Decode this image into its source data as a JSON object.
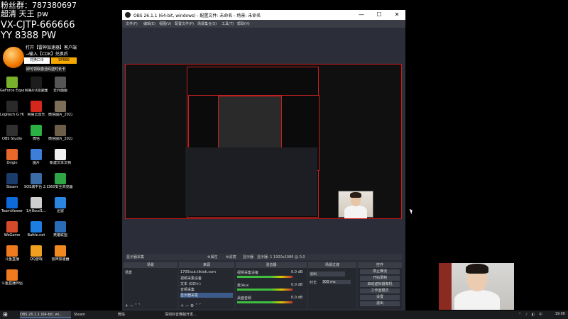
{
  "overlay": {
    "line1": "粉丝群：787380697",
    "line2": "超清 天王 pw",
    "line3": "VX-CJTP-666666",
    "line4": "YY 8388 PW"
  },
  "promo": {
    "l1": "打开【雷神加速器】客户端",
    "l2": "→输入【CDK】兑换后",
    "pill1": "兑换口令",
    "pill2": "SP666",
    "l3": "即可领取激活码送时长卡"
  },
  "desktop_icons": [
    {
      "label": "GeForce Experience",
      "color": "#79b12c"
    },
    {
      "label": "网易UU加速器",
      "color": "#1d1d1d"
    },
    {
      "label": "去外面版",
      "color": "#555555"
    },
    {
      "label": "Logitech G HUB",
      "color": "#2a2a2a"
    },
    {
      "label": "网易云音乐",
      "color": "#d4281d"
    },
    {
      "label": "微信图片_2022111",
      "color": "#7d6e5a"
    },
    {
      "label": "OBS Studio",
      "color": "#303030"
    },
    {
      "label": "微信",
      "color": "#2ab043"
    },
    {
      "label": "微信图片_2022091",
      "color": "#6d5e4a"
    },
    {
      "label": "Origin",
      "color": "#e8682c"
    },
    {
      "label": "图片",
      "color": "#3d7ed8"
    },
    {
      "label": "新建文本文档",
      "color": "#f0f0f0"
    },
    {
      "label": "Steam",
      "color": "#1b3c6a"
    },
    {
      "label": "SOS城平台 2.0",
      "color": "#3c6ca8"
    },
    {
      "label": "360安全浏览器",
      "color": "#2fa545"
    },
    {
      "label": "TeamViewer",
      "color": "#0e6ad8"
    },
    {
      "label": "1月8ocd1…",
      "color": "#cfcfcf"
    },
    {
      "label": "迅雷",
      "color": "#2a86e0"
    },
    {
      "label": "WeGame",
      "color": "#d44a2a"
    },
    {
      "label": "Battle.net",
      "color": "#1c7ee0"
    },
    {
      "label": "英雄联盟",
      "color": "#2b6cb8"
    },
    {
      "label": "斗鱼直播",
      "color": "#f07a20"
    },
    {
      "label": "QQ游戏",
      "color": "#f0a020"
    },
    {
      "label": "雷神加速器",
      "color": "#f08a20"
    },
    {
      "label": "斗鱼直播伴侣",
      "color": "#f07a20"
    }
  ],
  "obs": {
    "title": "OBS 26.1.1 (64-bit, windows) - 配置文件: 未命名 - 场景: 未命名",
    "btn_min": "—",
    "btn_max": "☐",
    "btn_close": "✕",
    "menu": [
      "文件(F)",
      "编辑(E)",
      "视图(V)",
      "配置文件(P)",
      "场景集合(S)",
      "工具(T)",
      "帮助(H)"
    ],
    "scene_bar": {
      "name": "显示器采集",
      "props": "⚙属性",
      "filters": "⚙滤镜",
      "display": "显示器",
      "display_val": "显示器: 1  1920x1080 @ 0,0"
    },
    "scenes": {
      "header": "场景",
      "items": [
        "场景"
      ],
      "footer": "+ − ˄ ˅"
    },
    "sources": {
      "header": "来源",
      "items": [
        "1705icut.tiktok.com",
        "视频采集设备",
        "文本 (GDI+)",
        "音频采集",
        "显示器采集"
      ],
      "footer": "+ − ⚙ ˄ ˅"
    },
    "mixer": {
      "header": "混音器",
      "items": [
        "视频采集设备",
        "麦/Aux",
        "桌面音频"
      ],
      "db": [
        "0.0 dB",
        "0.0 dB",
        "0.0 dB"
      ]
    },
    "transitions": {
      "header": "场景过渡",
      "type": "淡出",
      "duration_label": "时长",
      "duration_value": "300 ms"
    },
    "controls": {
      "header": "控件",
      "buttons": [
        "停止推流",
        "开始录制",
        "启动虚拟摄像机",
        "工作室模式",
        "设置",
        "退出"
      ]
    }
  },
  "taskbar": {
    "start": "⊞",
    "items": [
      "OBS 26.1.1 (64-bit, wi…",
      "Steam",
      "微信",
      "深圳抖音舞蹈开发…"
    ],
    "tray": "^ ♪ ◧ 中",
    "clock": "19:00"
  }
}
